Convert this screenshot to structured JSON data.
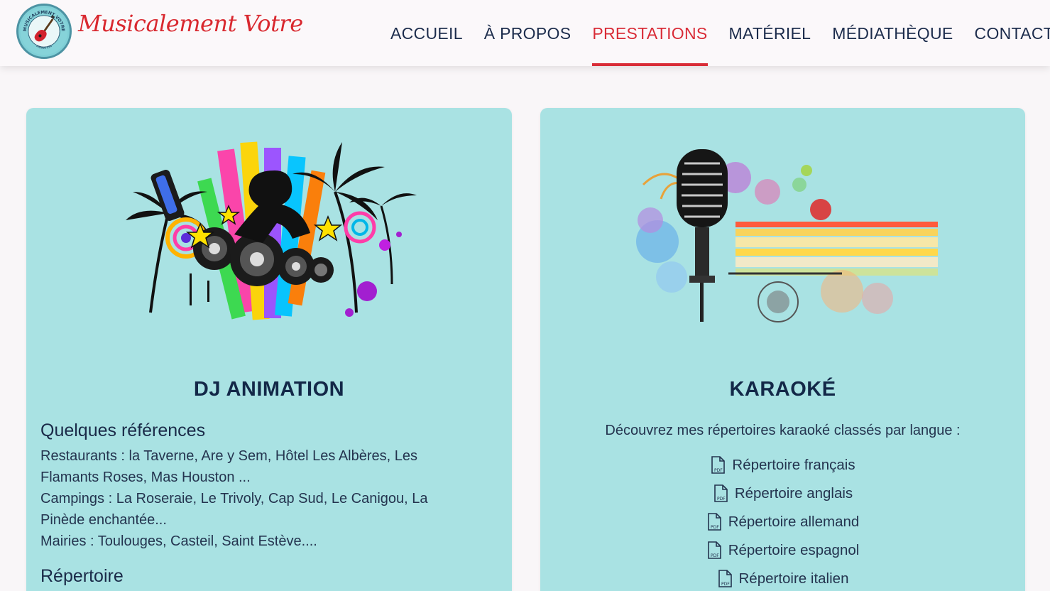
{
  "header": {
    "brand": "Musicalement Votre",
    "logo_text": "MUSICALEMENT VOTRE",
    "logo_subtext": "ANIMATION",
    "logo_icon": "electric-guitar-icon",
    "accent_color": "#d92c37",
    "nav": [
      {
        "label": "ACCUEIL",
        "active": false
      },
      {
        "label": "À PROPOS",
        "active": false
      },
      {
        "label": "PRESTATIONS",
        "active": true
      },
      {
        "label": "MATÉRIEL",
        "active": false
      },
      {
        "label": "MÉDIATHÈQUE",
        "active": false
      },
      {
        "label": "CONTACT",
        "active": false
      }
    ]
  },
  "cards": {
    "dj": {
      "title": "DJ ANIMATION",
      "image": "dj-party-illustration",
      "references_heading": "Quelques références",
      "references": [
        "Restaurants : la Taverne, Are y Sem, Hôtel Les Albères, Les Flamants Roses, Mas Houston ...",
        "Campings : La Roseraie, Le Trivoly, Cap Sud, Le Canigou, La Pinède enchantée...",
        "Mairies : Toulouges, Casteil, Saint Estève...."
      ],
      "repertoire_heading": "Répertoire"
    },
    "karaoke": {
      "title": "KARAOKÉ",
      "image": "vintage-microphone-illustration",
      "intro": "Découvrez mes répertoires karaoké classés par langue :",
      "files": [
        {
          "label": "Répertoire français",
          "icon": "pdf-file-icon"
        },
        {
          "label": "Répertoire anglais",
          "icon": "pdf-file-icon"
        },
        {
          "label": "Répertoire allemand",
          "icon": "pdf-file-icon"
        },
        {
          "label": "Répertoire espagnol",
          "icon": "pdf-file-icon"
        },
        {
          "label": "Répertoire italien",
          "icon": "pdf-file-icon"
        }
      ]
    }
  },
  "colors": {
    "card_bg": "#a9e2e3",
    "title": "#132848",
    "text": "#24344f"
  }
}
